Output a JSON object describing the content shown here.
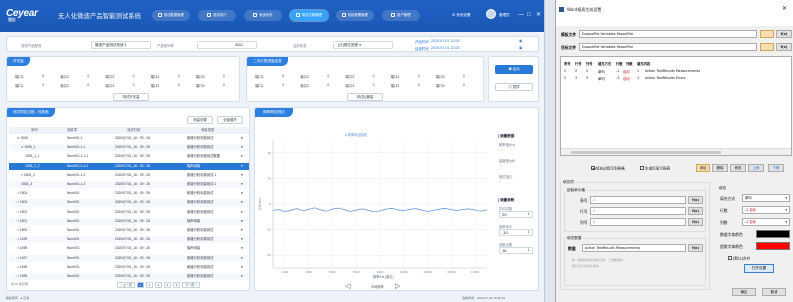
{
  "app": {
    "logo_text": "Ceyear",
    "logo_sub": "思仪",
    "title": "无人化微波产品智能测试系统",
    "nav_tabs": [
      {
        "label": "测试数据管理",
        "active": false
      },
      {
        "label": "测试执行",
        "active": false
      },
      {
        "label": "系统状态",
        "active": false
      },
      {
        "label": "测试过程管理",
        "active": true
      },
      {
        "label": "系统报警管理",
        "active": false
      },
      {
        "label": "用户管理",
        "active": false
      }
    ],
    "user_label": "系统设置",
    "user_name": "管理员",
    "win_controls": [
      "—",
      "□",
      "✕"
    ]
  },
  "info_row": {
    "product_label": "测试产品型号",
    "product_value": "微波产品测试系统 1",
    "serial_label": "产品序列号",
    "serial_value": "0001",
    "status_label": "当前状态",
    "status_value": "[计]测试进程 ●",
    "start_label": "开始时间",
    "start_value": "2020-07-01 12:00",
    "end_label": "结束时间",
    "end_value": "2020-07-01 12:00"
  },
  "signal_panel_left": {
    "title": "开关量",
    "signals_row1": [
      {
        "name": "端口1",
        "value": "0"
      },
      {
        "name": "端口2",
        "value": "0"
      },
      {
        "name": "端口3",
        "value": "0"
      },
      {
        "name": "端口4",
        "value": "0"
      },
      {
        "name": "端口5",
        "value": "0"
      }
    ],
    "signals_row2": [
      {
        "name": "端口1",
        "value": "0"
      },
      {
        "name": "端口2",
        "value": "0"
      },
      {
        "name": "端口3",
        "value": "0"
      },
      {
        "name": "端口4",
        "value": "0"
      },
      {
        "name": "端口5",
        "value": "0"
      }
    ],
    "button": "测试开关量"
  },
  "signal_panel_right": {
    "title": "二次仪表测量信息",
    "signals_row1": [
      {
        "name": "端口1",
        "value": "0"
      },
      {
        "name": "端口2",
        "value": "0"
      },
      {
        "name": "端口3",
        "value": "0"
      },
      {
        "name": "端口4",
        "value": "0"
      },
      {
        "name": "端口5",
        "value": "0"
      }
    ],
    "signals_row2": [
      {
        "name": "端口1",
        "value": "0"
      },
      {
        "name": "端口2",
        "value": "0"
      },
      {
        "name": "端口3",
        "value": "0"
      },
      {
        "name": "端口4",
        "value": "0"
      },
      {
        "name": "端口5",
        "value": "0"
      }
    ],
    "button": "测试仪器量",
    "side_buttons": [
      "启动",
      "暂停"
    ]
  },
  "process_panel": {
    "title": "测试项目过程 - 列表面",
    "buttons": [
      "测量设置",
      "全部展开"
    ],
    "columns": [
      "序列",
      "测量项",
      "测试时间",
      "测量类型"
    ],
    "rows": [
      {
        "seq": "∨ 1505",
        "item": "Num001-1",
        "time": "2020/07/01_16 : 39 : 28",
        "type": "频谱分析测量测试",
        "level": 0,
        "selected": false
      },
      {
        "seq": "∨ 1505_1",
        "item": "Num001-1-1",
        "time": "2020/07/01_16 : 39 : 28",
        "type": "频谱分析测量测试",
        "level": 1,
        "selected": false
      },
      {
        "seq": "1505_1_1",
        "item": "Num001-1-1-1",
        "time": "2020/07/01_16 : 39 : 28",
        "type": "频谱分析测量测试数据",
        "level": 2,
        "selected": false
      },
      {
        "seq": "1505_1_2",
        "item": "Num001-1-1-2",
        "time": "2020/07/01_16 : 39 : 28",
        "type": "噪声测量",
        "level": 2,
        "selected": true
      },
      {
        "seq": "> 1505_2",
        "item": "Num001-1-2",
        "time": "2020/07/01_16 : 39 : 28",
        "type": "频谱分析测量测试-1",
        "level": 1,
        "selected": false
      },
      {
        "seq": "1505_3",
        "item": "Num001-1-3",
        "time": "2020/07/01_16 : 39 : 28",
        "type": "频谱分析测量测试-1",
        "level": 1,
        "selected": false
      },
      {
        "seq": "> 1504",
        "item": "Num001",
        "time": "2020/07/01_16 : 39 : 28",
        "type": "频谱分析测量测试",
        "level": 0,
        "selected": false
      },
      {
        "seq": "> 1503",
        "item": "Num001",
        "time": "2020/07/01_16 : 39 : 28",
        "type": "频谱分析测量测试",
        "level": 0,
        "selected": false
      },
      {
        "seq": "> 1502",
        "item": "Num001",
        "time": "2020/07/01_16 : 39 : 28",
        "type": "频谱分析测量测试",
        "level": 0,
        "selected": false
      },
      {
        "seq": "> 1501",
        "item": "Num001",
        "time": "2020/07/01_16 : 39 : 28",
        "type": "噪声测量",
        "level": 0,
        "selected": false
      },
      {
        "seq": "> 1500",
        "item": "Num001",
        "time": "2020/07/01_16 : 39 : 28",
        "type": "频谱分析测量测试",
        "level": 0,
        "selected": false
      },
      {
        "seq": "> 1499",
        "item": "Num001",
        "time": "2020/07/01_16 : 39 : 28",
        "type": "频谱分析测量测试",
        "level": 0,
        "selected": false
      },
      {
        "seq": "> 1498",
        "item": "Num001",
        "time": "2020/07/01_16 : 39 : 28",
        "type": "噪声测量",
        "level": 0,
        "selected": false
      },
      {
        "seq": "> 1497",
        "item": "Num001",
        "time": "2020/07/01_16 : 39 : 28",
        "type": "频谱分析测量测试",
        "level": 0,
        "selected": false
      },
      {
        "seq": "> 1496",
        "item": "Num001",
        "time": "2020/07/01_16 : 39 : 28",
        "type": "频谱分析测量测试",
        "level": 0,
        "selected": false
      },
      {
        "seq": "> 1495",
        "item": "Num001",
        "time": "2020/07/01_16 : 39 : 28",
        "type": "频谱分析测量测试",
        "level": 0,
        "selected": false
      }
    ],
    "pager": [
      "< 上一页",
      "1",
      "2",
      "3",
      "4",
      "5",
      "下一页 >"
    ],
    "total_label": "共 15 条记录"
  },
  "chart_panel": {
    "title": "频率响应测试",
    "legend": "● 频率响应曲线",
    "bottom_label": "中间频率",
    "nav_left": "◁",
    "nav_right": "▷"
  },
  "chart_data": {
    "type": "line",
    "title": "",
    "xlabel": "频率/Hz (单位)",
    "ylabel": "功率/dBm",
    "x": [
      0,
      500,
      1000,
      1500,
      2000,
      2500,
      3000,
      3500,
      4000,
      4500,
      5000,
      5500,
      6000,
      6500,
      7000,
      7500,
      8000,
      8500,
      9000,
      9500,
      10000,
      10500,
      11000,
      11500,
      12000,
      12500,
      13000,
      13500,
      14000,
      14500,
      15000,
      15500,
      16000,
      16500,
      17000,
      17500,
      18000
    ],
    "series": [
      {
        "name": "频率响应曲线",
        "values": [
          -2.5,
          -2.2,
          -3.0,
          -2.4,
          -1.8,
          -2.6,
          -2.1,
          -1.5,
          -2.3,
          -2.8,
          -2.0,
          -1.6,
          -2.2,
          -2.9,
          -2.4,
          -1.9,
          -2.5,
          -3.1,
          -2.7,
          -2.0,
          -1.7,
          -2.3,
          -2.6,
          -2.1,
          -1.8,
          -2.4,
          -2.9,
          -2.5,
          -2.0,
          -1.7,
          -2.2,
          -2.6,
          -2.1,
          -1.9,
          -2.4,
          -2.8,
          -2.3
        ]
      }
    ],
    "xlim": [
      0,
      18000
    ],
    "ylim": [
      -25,
      25
    ],
    "x_ticks": [
      "1000",
      "3000",
      "5000",
      "7000",
      "9000",
      "11000",
      "13000",
      "15000",
      "17000"
    ],
    "y_ticks": [
      "20",
      "10",
      "0",
      "-10",
      "-20"
    ],
    "grid": true,
    "line_color": "#5b8fd6"
  },
  "chart_side": {
    "group1_title": "| 测量数据",
    "g1_items": [
      {
        "label": "频率值(Hz)",
        "value": "--"
      },
      {
        "label": "幅度值(dB)",
        "value": "--"
      },
      {
        "label": "相位值(°)",
        "value": "--"
      }
    ],
    "group2_title": "| 测量参数",
    "g2_items": [
      {
        "label": "平均次数",
        "value": "20"
      },
      {
        "label": "参考电平",
        "value": "-10"
      },
      {
        "label": "测量点数",
        "value": "16"
      }
    ]
  },
  "status_bar": {
    "left": "版权所有 · ● 正常",
    "right": "当前时间：2020-07-01 16:39:28"
  },
  "dialog": {
    "title": "Word报表生成设置",
    "template_label": "模板文件",
    "template_value": "ExposeFile Variables ReportFile",
    "target_label": "目标文件",
    "target_value": "ExposeFile Variables ReportFile",
    "browse_label": "",
    "open_label": "打开",
    "table_columns": [
      "表号",
      "行号",
      "列号",
      "填充方式",
      "行数",
      "列数",
      "填充内容"
    ],
    "table_rows": [
      [
        "2",
        "2",
        "2",
        "单列",
        "-1",
        "自动",
        "1",
        "Action TestResults Measurements"
      ],
      [
        "2",
        "3",
        "3",
        "单列",
        "-1",
        "自动",
        "1",
        "Action TestResults Errors"
      ]
    ],
    "check_auto_insert": "填充过程写到表格",
    "check_generate": "生成后显示报表",
    "btn_add": "添加",
    "btn_delete": "删除",
    "btn_modify": "修改",
    "btn_up": "上移",
    "btn_down": "下移",
    "fill_group": "填充项",
    "start_cell_group": "起始单元格",
    "table_no_label": "表号",
    "row_no_label": "行号",
    "col_no_label": "列号",
    "f_label": "f(x)",
    "fill_mode_group": "填充",
    "fill_mode_label": "填充方式",
    "fill_mode_value": "单列",
    "rows_label": "行数",
    "rows_value": "-1",
    "rows_mode": "自动",
    "cols_label": "列数",
    "cols_value": "-1",
    "cols_mode": "自动",
    "data_group": "填充数据",
    "data_label": "数据",
    "data_value": "Action TestResults Measurements",
    "hint_lines": [
      "· 单一数据时填充到单元格，二维数组时",
      "· 按行列方式依次填充"
    ],
    "font_color_label": "数据字体颜色",
    "font_color": "#000000",
    "error_color_label": "超限字体颜色",
    "error_color": "#ff0000",
    "merge_label": "[默认]合并",
    "merge_btn": "打开设置",
    "ok": "确定",
    "cancel": "取消"
  }
}
